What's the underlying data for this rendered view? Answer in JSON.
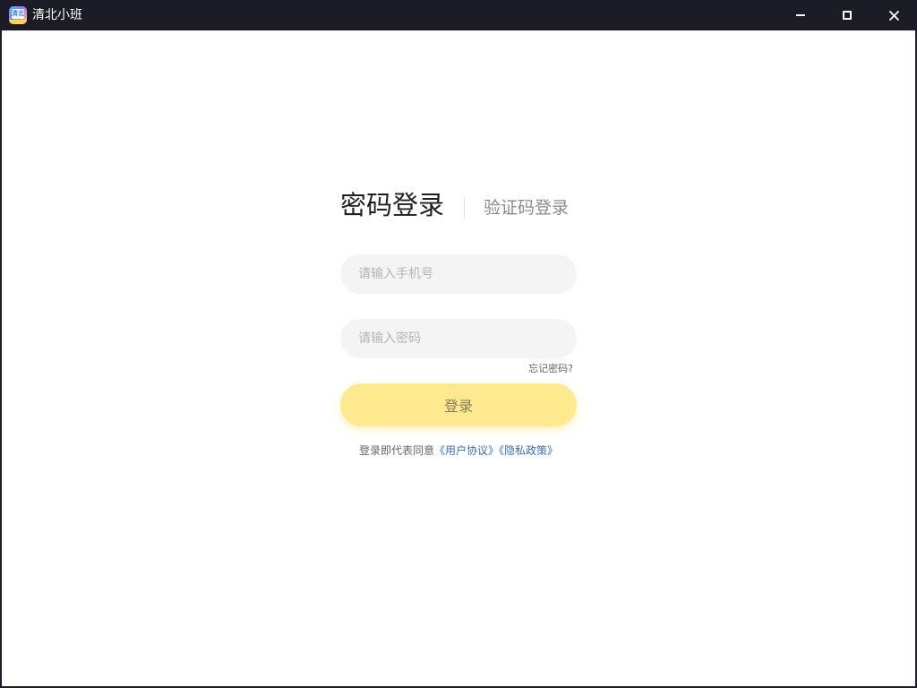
{
  "window": {
    "title": "清北小班",
    "icon_text": "清北",
    "controls": {
      "minimize": "minimize",
      "maximize": "maximize",
      "close": "✕"
    }
  },
  "login": {
    "tabs": {
      "active": "密码登录",
      "inactive": "验证码登录"
    },
    "phone_placeholder": "请输入手机号",
    "phone_value": "",
    "password_placeholder": "请输入密码",
    "password_value": "",
    "forgot_password": "忘记密码?",
    "submit_label": "登录",
    "agreement": {
      "prefix": "登录即代表同意",
      "user_agreement": "《用户协议》",
      "privacy_policy": "《隐私政策》"
    }
  },
  "colors": {
    "titlebar": "#1b1c26",
    "background": "#ffffff",
    "input_bg": "#f4f4f4",
    "button_bg": "#ffe98f",
    "link": "#3a6fb7"
  }
}
